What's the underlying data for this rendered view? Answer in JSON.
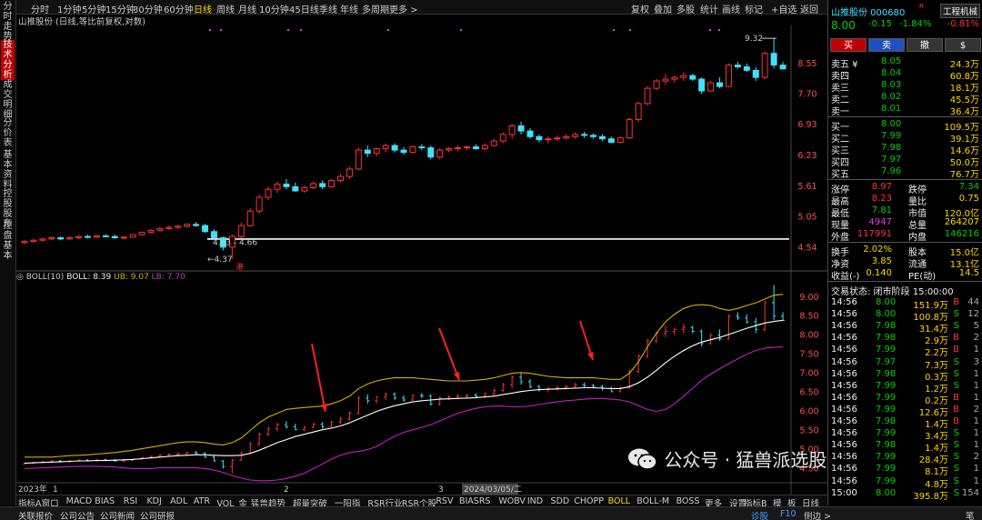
{
  "left_tabs": [
    "分时走势",
    "技术分析",
    "成交明细",
    "分价表",
    "基本资料",
    "控股股东",
    "控盘基本"
  ],
  "top_periods": [
    "分时",
    "1分钟",
    "5分钟",
    "15分钟",
    "30分钟",
    "60分钟",
    "日线",
    "周线",
    "月线",
    "10分钟",
    "45日线",
    "季线",
    "年线",
    "多周期",
    "更多 >"
  ],
  "top_periods_active": 6,
  "top_tools": [
    "复权",
    "叠加",
    "多股",
    "统计",
    "画线",
    "标记",
    "+自选",
    "返回"
  ],
  "chart_title": "山推股份 (日线,等比前复权,对数)",
  "price_ticks": [
    "8.55",
    "7.70",
    "6.93",
    "6.23",
    "5.61",
    "5.05",
    "4.54"
  ],
  "boll_ticks": [
    "9.00",
    "8.50",
    "8.00",
    "7.50",
    "7.00",
    "6.50",
    "6.00",
    "5.50",
    "5.00",
    "4.50"
  ],
  "annotations": {
    "high": "9.32",
    "low": "4.37",
    "range": "4.63 - 4.66",
    "badge": "港",
    "line_price": "4.68"
  },
  "boll_header": {
    "name": "BOLL(10)",
    "boll_label": "BOLL: 8.39",
    "ub_label": "UB: 9.07",
    "lb_label": "LB: 7.70"
  },
  "x_labels": [
    "2023年",
    "1",
    "2",
    "3",
    "2024/03/05/二"
  ],
  "bottom_tabs": [
    "指标A",
    "窗口",
    "MACD",
    "BIAS",
    "RSI",
    "KDJ",
    "ADL",
    "ATR",
    "VOL_金",
    "猛兽趋势",
    "超量突破",
    "一阳指",
    "RSR行业",
    "RSR个股",
    "RSV",
    "BIASRS",
    "WOBV",
    "IND",
    "SDD",
    "CHOPP",
    "BOLL",
    "BOLL-M",
    "BOSS",
    "更多",
    "设置"
  ],
  "bottom_tabs_active": 20,
  "bottom_right": [
    "指标B",
    "模",
    "板",
    "日线"
  ],
  "footer_items": [
    "关联报价",
    "公司公告",
    "公司新闻",
    "公司研报"
  ],
  "footer_right": [
    "诊股",
    "F10",
    "侧边 >",
    "笔"
  ],
  "watermark": "公众号 · 猛兽派选股",
  "stock": {
    "name": "山推股份",
    "code": "000680",
    "tag": "R",
    "industry": "工程机械",
    "price": "8.00",
    "change": "-0.15",
    "pct": "-1.84%",
    "pct_badge": "-0.81%"
  },
  "trade_buttons": [
    "买",
    "卖",
    "撤",
    "$"
  ],
  "asks": [
    {
      "label": "卖五 ¥",
      "price": "8.05",
      "vol": "24.3万"
    },
    {
      "label": "卖四",
      "price": "8.04",
      "vol": "60.8万"
    },
    {
      "label": "卖三",
      "price": "8.03",
      "vol": "18.1万"
    },
    {
      "label": "卖二",
      "price": "8.02",
      "vol": "45.5万"
    },
    {
      "label": "卖一",
      "price": "8.01",
      "vol": "36.4万"
    }
  ],
  "bids": [
    {
      "label": "买一",
      "price": "8.00",
      "vol": "109.5万"
    },
    {
      "label": "买二",
      "price": "7.99",
      "vol": "39.1万"
    },
    {
      "label": "买三",
      "price": "7.98",
      "vol": "14.6万"
    },
    {
      "label": "买四",
      "price": "7.97",
      "vol": "50.0万"
    },
    {
      "label": "买五",
      "price": "7.96",
      "vol": "76.7万"
    }
  ],
  "stats": [
    [
      "涨停",
      "8.97",
      "跌停",
      "7.34"
    ],
    [
      "最高",
      "8.23",
      "量比",
      "0.75"
    ],
    [
      "最低",
      "7.81",
      "市值",
      "120.0亿"
    ],
    [
      "现量",
      "4947",
      "总量",
      "264207"
    ],
    [
      "外盘",
      "117991",
      "内盘",
      "146216"
    ]
  ],
  "stats2": [
    [
      "换手",
      "2.02%",
      "股本",
      "15.0亿"
    ],
    [
      "净资",
      "3.85",
      "流通",
      "13.1亿"
    ],
    [
      "收益(-)",
      "0.140",
      "PE(动)",
      "14.5"
    ]
  ],
  "trade_status": "交易状态: 闭市阶段 15:00:00",
  "ticks": [
    {
      "t": "14:56",
      "p": "8.00",
      "v": "151.9万",
      "s": "B",
      "n": "44"
    },
    {
      "t": "14:56",
      "p": "8.00",
      "v": "100.8万",
      "s": "S",
      "n": "12"
    },
    {
      "t": "14:56",
      "p": "7.98",
      "v": "31.4万",
      "s": "S",
      "n": "5"
    },
    {
      "t": "14:56",
      "p": "7.98",
      "v": "2.9万",
      "s": "B",
      "n": "2"
    },
    {
      "t": "14:56",
      "p": "7.99",
      "v": "2.2万",
      "s": "B",
      "n": "1"
    },
    {
      "t": "14:56",
      "p": "7.97",
      "v": "7.3万",
      "s": "S",
      "n": "3"
    },
    {
      "t": "14:56",
      "p": "7.98",
      "v": "0.3万",
      "s": "S",
      "n": "1"
    },
    {
      "t": "14:56",
      "p": "7.99",
      "v": "1.2万",
      "s": "S",
      "n": "1"
    },
    {
      "t": "14:56",
      "p": "7.99",
      "v": "0.2万",
      "s": "B",
      "n": "1"
    },
    {
      "t": "14:56",
      "p": "7.99",
      "v": "12.6万",
      "s": "B",
      "n": "2"
    },
    {
      "t": "14:56",
      "p": "7.98",
      "v": "1.4万",
      "s": "B",
      "n": "1"
    },
    {
      "t": "14:56",
      "p": "7.99",
      "v": "3.4万",
      "s": "S",
      "n": "1"
    },
    {
      "t": "14:56",
      "p": "7.98",
      "v": "1.4万",
      "s": "S",
      "n": "1"
    },
    {
      "t": "14:56",
      "p": "7.99",
      "v": "28.4万",
      "s": "S",
      "n": "2"
    },
    {
      "t": "14:56",
      "p": "7.99",
      "v": "8.1万",
      "s": "S",
      "n": "1"
    },
    {
      "t": "14:56",
      "p": "7.99",
      "v": "4.8万",
      "s": "S",
      "n": "1"
    },
    {
      "t": "15:00",
      "p": "8.00",
      "v": "395.8万",
      "s": "S",
      "n": "154"
    }
  ],
  "colors": {
    "up": "#ff3232",
    "down": "#40e0ff",
    "mid": "#ffffff",
    "ub": "#d4b000",
    "lb": "#c020c0"
  },
  "chart_data": {
    "type": "candlestick",
    "title": "山推股份 (日线,等比前复权,对数)",
    "indicator": "BOLL(10)",
    "price_axis": [
      4.54,
      5.05,
      5.61,
      6.23,
      6.93,
      7.7,
      8.55
    ],
    "boll_axis": [
      4.5,
      5.0,
      5.5,
      6.0,
      6.5,
      7.0,
      7.5,
      8.0,
      8.5,
      9.0
    ],
    "ohlc": [
      [
        4.62,
        4.66,
        4.6,
        4.64
      ],
      [
        4.64,
        4.68,
        4.62,
        4.66
      ],
      [
        4.66,
        4.7,
        4.64,
        4.68
      ],
      [
        4.68,
        4.72,
        4.66,
        4.7
      ],
      [
        4.7,
        4.72,
        4.66,
        4.68
      ],
      [
        4.68,
        4.72,
        4.66,
        4.7
      ],
      [
        4.7,
        4.74,
        4.68,
        4.72
      ],
      [
        4.72,
        4.75,
        4.69,
        4.71
      ],
      [
        4.71,
        4.74,
        4.69,
        4.73
      ],
      [
        4.73,
        4.76,
        4.71,
        4.72
      ],
      [
        4.72,
        4.75,
        4.68,
        4.7
      ],
      [
        4.7,
        4.73,
        4.67,
        4.71
      ],
      [
        4.71,
        4.76,
        4.7,
        4.75
      ],
      [
        4.75,
        4.8,
        4.73,
        4.79
      ],
      [
        4.79,
        4.84,
        4.77,
        4.82
      ],
      [
        4.82,
        4.88,
        4.8,
        4.85
      ],
      [
        4.85,
        4.9,
        4.83,
        4.87
      ],
      [
        4.87,
        4.92,
        4.84,
        4.89
      ],
      [
        4.89,
        4.94,
        4.86,
        4.92
      ],
      [
        4.92,
        4.96,
        4.88,
        4.9
      ],
      [
        4.9,
        4.93,
        4.78,
        4.8
      ],
      [
        4.8,
        4.84,
        4.68,
        4.7
      ],
      [
        4.7,
        4.72,
        4.5,
        4.55
      ],
      [
        4.55,
        4.75,
        4.37,
        4.72
      ],
      [
        4.72,
        4.95,
        4.7,
        4.9
      ],
      [
        4.9,
        5.2,
        4.88,
        5.15
      ],
      [
        5.15,
        5.45,
        5.1,
        5.4
      ],
      [
        5.4,
        5.6,
        5.35,
        5.55
      ],
      [
        5.55,
        5.7,
        5.48,
        5.65
      ],
      [
        5.65,
        5.75,
        5.55,
        5.6
      ],
      [
        5.6,
        5.68,
        5.5,
        5.52
      ],
      [
        5.52,
        5.62,
        5.48,
        5.58
      ],
      [
        5.58,
        5.7,
        5.55,
        5.66
      ],
      [
        5.66,
        5.72,
        5.55,
        5.6
      ],
      [
        5.6,
        5.75,
        5.58,
        5.72
      ],
      [
        5.72,
        5.85,
        5.68,
        5.8
      ],
      [
        5.8,
        6.0,
        5.75,
        5.95
      ],
      [
        5.95,
        6.4,
        5.92,
        6.35
      ],
      [
        6.35,
        6.45,
        6.2,
        6.28
      ],
      [
        6.28,
        6.4,
        6.22,
        6.38
      ],
      [
        6.38,
        6.5,
        6.3,
        6.45
      ],
      [
        6.45,
        6.5,
        6.3,
        6.35
      ],
      [
        6.35,
        6.42,
        6.25,
        6.3
      ],
      [
        6.3,
        6.45,
        6.28,
        6.42
      ],
      [
        6.42,
        6.48,
        6.35,
        6.4
      ],
      [
        6.4,
        6.45,
        6.15,
        6.2
      ],
      [
        6.2,
        6.4,
        6.15,
        6.35
      ],
      [
        6.35,
        6.42,
        6.3,
        6.38
      ],
      [
        6.38,
        6.45,
        6.32,
        6.4
      ],
      [
        6.4,
        6.45,
        6.35,
        6.42
      ],
      [
        6.42,
        6.48,
        6.36,
        6.38
      ],
      [
        6.38,
        6.5,
        6.35,
        6.45
      ],
      [
        6.45,
        6.6,
        6.42,
        6.55
      ],
      [
        6.55,
        6.75,
        6.5,
        6.7
      ],
      [
        6.7,
        6.95,
        6.6,
        6.9
      ],
      [
        6.9,
        7.0,
        6.7,
        6.78
      ],
      [
        6.78,
        6.85,
        6.6,
        6.65
      ],
      [
        6.65,
        6.7,
        6.52,
        6.58
      ],
      [
        6.58,
        6.65,
        6.5,
        6.6
      ],
      [
        6.6,
        6.68,
        6.55,
        6.62
      ],
      [
        6.62,
        6.7,
        6.58,
        6.65
      ],
      [
        6.65,
        6.75,
        6.6,
        6.7
      ],
      [
        6.7,
        6.76,
        6.62,
        6.68
      ],
      [
        6.68,
        6.72,
        6.6,
        6.65
      ],
      [
        6.65,
        6.7,
        6.55,
        6.6
      ],
      [
        6.6,
        6.65,
        6.5,
        6.52
      ],
      [
        6.52,
        6.65,
        6.5,
        6.62
      ],
      [
        6.62,
        7.1,
        6.6,
        7.05
      ],
      [
        7.05,
        7.5,
        7.0,
        7.45
      ],
      [
        7.45,
        7.9,
        7.4,
        7.85
      ],
      [
        7.85,
        8.1,
        7.8,
        8.05
      ],
      [
        8.05,
        8.25,
        7.95,
        8.1
      ],
      [
        8.1,
        8.2,
        8.0,
        8.15
      ],
      [
        8.15,
        8.3,
        8.05,
        8.2
      ],
      [
        8.2,
        8.25,
        8.05,
        8.1
      ],
      [
        8.1,
        8.15,
        7.7,
        7.78
      ],
      [
        7.78,
        8.05,
        7.75,
        8.0
      ],
      [
        8.0,
        8.15,
        7.85,
        7.9
      ],
      [
        7.9,
        8.55,
        7.88,
        8.5
      ],
      [
        8.5,
        8.6,
        8.4,
        8.45
      ],
      [
        8.45,
        8.55,
        8.3,
        8.35
      ],
      [
        8.35,
        8.45,
        8.05,
        8.15
      ],
      [
        8.15,
        8.9,
        8.1,
        8.85
      ],
      [
        8.85,
        9.32,
        8.4,
        8.5
      ],
      [
        8.5,
        8.6,
        8.38,
        8.39
      ]
    ],
    "ub_line": [
      4.8,
      4.8,
      4.8,
      4.8,
      4.82,
      4.84,
      4.85,
      4.86,
      4.88,
      4.9,
      4.92,
      4.95,
      4.98,
      5.02,
      5.06,
      5.1,
      5.14,
      5.18,
      5.2,
      5.2,
      5.18,
      5.14,
      5.12,
      5.18,
      5.3,
      5.5,
      5.7,
      5.85,
      5.95,
      6.05,
      6.08,
      6.1,
      6.12,
      6.14,
      6.2,
      6.28,
      6.4,
      6.6,
      6.72,
      6.8,
      6.85,
      6.88,
      6.88,
      6.88,
      6.86,
      6.84,
      6.82,
      6.8,
      6.8,
      6.8,
      6.82,
      6.84,
      6.88,
      6.94,
      7.0,
      7.02,
      7.0,
      6.96,
      6.92,
      6.9,
      6.88,
      6.88,
      6.88,
      6.88,
      6.86,
      6.84,
      6.84,
      7.0,
      7.3,
      7.7,
      8.05,
      8.35,
      8.55,
      8.7,
      8.78,
      8.8,
      8.78,
      8.7,
      8.65,
      8.7,
      8.78,
      8.85,
      8.95,
      9.05,
      9.07
    ],
    "mid_line": [
      4.64,
      4.65,
      4.66,
      4.67,
      4.68,
      4.69,
      4.7,
      4.7,
      4.71,
      4.71,
      4.72,
      4.73,
      4.74,
      4.76,
      4.78,
      4.8,
      4.82,
      4.84,
      4.85,
      4.86,
      4.86,
      4.85,
      4.84,
      4.84,
      4.85,
      4.9,
      4.98,
      5.08,
      5.18,
      5.26,
      5.34,
      5.4,
      5.46,
      5.52,
      5.56,
      5.62,
      5.7,
      5.8,
      5.9,
      6.0,
      6.08,
      6.15,
      6.2,
      6.25,
      6.28,
      6.3,
      6.32,
      6.33,
      6.34,
      6.35,
      6.36,
      6.38,
      6.4,
      6.44,
      6.48,
      6.52,
      6.55,
      6.57,
      6.58,
      6.59,
      6.6,
      6.61,
      6.62,
      6.62,
      6.61,
      6.6,
      6.6,
      6.65,
      6.75,
      6.9,
      7.08,
      7.28,
      7.45,
      7.6,
      7.72,
      7.82,
      7.88,
      7.94,
      8.02,
      8.1,
      8.18,
      8.25,
      8.32,
      8.36,
      8.39
    ],
    "lb_line": [
      4.5,
      4.51,
      4.52,
      4.53,
      4.54,
      4.55,
      4.56,
      4.56,
      4.56,
      4.55,
      4.54,
      4.52,
      4.5,
      4.5,
      4.5,
      4.52,
      4.52,
      4.52,
      4.52,
      4.52,
      4.5,
      4.46,
      4.4,
      4.32,
      4.25,
      4.2,
      4.18,
      4.18,
      4.2,
      4.24,
      4.3,
      4.38,
      4.5,
      4.62,
      4.75,
      4.85,
      4.92,
      4.95,
      5.0,
      5.08,
      5.22,
      5.35,
      5.45,
      5.52,
      5.58,
      5.65,
      5.75,
      5.85,
      5.95,
      6.02,
      6.08,
      6.12,
      6.14,
      6.14,
      6.12,
      6.12,
      6.14,
      6.18,
      6.22,
      6.25,
      6.28,
      6.3,
      6.32,
      6.34,
      6.34,
      6.32,
      6.3,
      6.25,
      6.15,
      6.05,
      6.0,
      6.05,
      6.2,
      6.4,
      6.6,
      6.82,
      6.98,
      7.12,
      7.25,
      7.38,
      7.5,
      7.6,
      7.66,
      7.68,
      7.7
    ]
  }
}
